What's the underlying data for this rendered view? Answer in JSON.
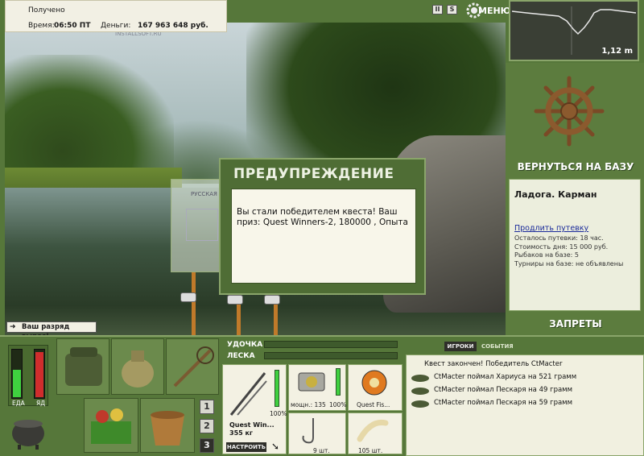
{
  "info": {
    "status": "Получено",
    "time_label": "Время:",
    "time_value": "06:50 ПТ",
    "money_label": "Деньги:",
    "money_value": "167 963 648 руб.",
    "watermark": "INSTALLSOFT.RU"
  },
  "top_buttons": {
    "pause": "II",
    "sound": "S",
    "menu": "МЕНЮ"
  },
  "depth": {
    "value": "1,12 m"
  },
  "right_panel": {
    "return_label": "ВЕРНУТЬСЯ НА БАЗУ",
    "location": "Ладога. Карман",
    "extend_link": "Продлить путевку",
    "lines": [
      "Осталось путевки: 18 час.",
      "Стоимость дня: 15 000 руб.",
      "Рыбаков на базе: 5",
      "Турниры на базе: не объявлены"
    ],
    "bans_label": "ЗАПРЕТЫ"
  },
  "dialog": {
    "title": "ПРЕДУПРЕЖДЕНИЕ",
    "text": "Вы стали победителем квеста! Ваш приз: Quest Winners-2, 180000 , Опыта"
  },
  "ghost": {
    "label": "РУССКАЯ"
  },
  "promo": {
    "text": "Ваш разряд вырос!"
  },
  "meters": {
    "food": "ЕДА",
    "poison": "ЯД",
    "food_level": 0.55,
    "poison_level": 0.9
  },
  "pages": [
    "1",
    "2",
    "3"
  ],
  "tackle": {
    "rod_label": "УДОЧКА",
    "line_label": "ЛЕСКА",
    "rod_name": "Quest Win...",
    "rod_weight": "355 кг",
    "rod_pct": "100%",
    "setup_button": "НАСТРОИТЬ",
    "reel_power": "мощн.: 135",
    "reel_pct": "100%",
    "line_name": "Quest Fis...",
    "hook_count": "9 шт.",
    "bait_count": "105 шт."
  },
  "events": {
    "tab_players": "ИГРОКИ",
    "tab_events": "СОБЫТИЯ",
    "items": [
      "Квест закончен! Победитель CtMacter",
      "CtMacter поймал Хариуса на 521 грамм",
      "CtMacter поймал Пескаря на 49 грамм",
      "CtMacter поймал Пескаря на 59 грамм"
    ]
  }
}
